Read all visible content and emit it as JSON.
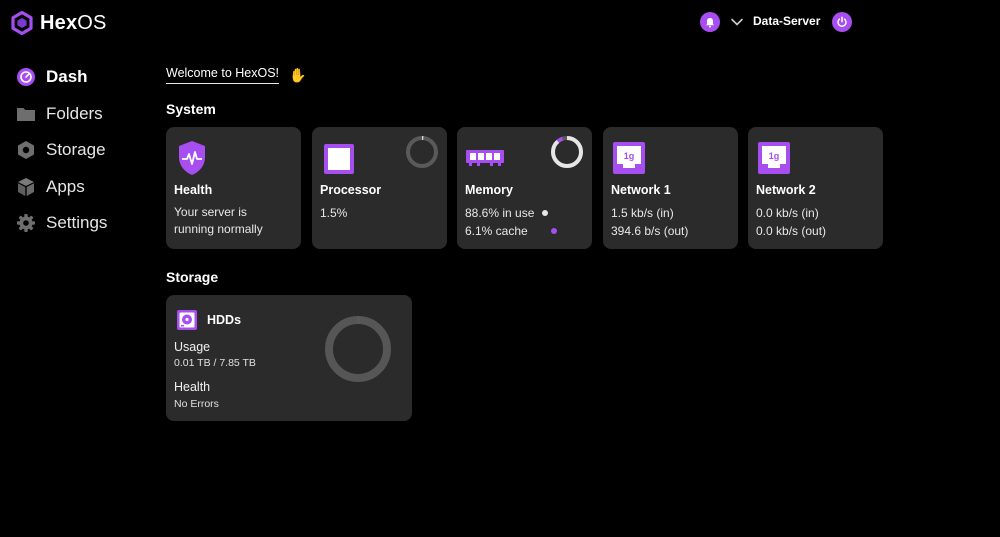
{
  "brand": {
    "name_bold": "Hex",
    "name_light": "OS",
    "accent": "#a64ef0"
  },
  "topbar": {
    "server_name": "Data-Server"
  },
  "sidebar": {
    "items": [
      {
        "label": "Dash",
        "icon": "dash-icon",
        "active": true
      },
      {
        "label": "Folders",
        "icon": "folder-icon",
        "active": false
      },
      {
        "label": "Storage",
        "icon": "storage-icon",
        "active": false
      },
      {
        "label": "Apps",
        "icon": "apps-icon",
        "active": false
      },
      {
        "label": "Settings",
        "icon": "gear-icon",
        "active": false
      }
    ]
  },
  "main": {
    "welcome": "Welcome to HexOS!",
    "system_title": "System",
    "storage_title": "Storage",
    "cards": {
      "health": {
        "title": "Health",
        "line1": "Your server is",
        "line2": "running normally"
      },
      "processor": {
        "title": "Processor",
        "value": "1.5%",
        "usage_fraction": 0.015
      },
      "memory": {
        "title": "Memory",
        "in_use": "88.6% in use",
        "cache": "6.1% cache",
        "in_use_fraction": 0.886,
        "cache_fraction": 0.061
      },
      "network1": {
        "title": "Network 1",
        "in": "1.5 kb/s (in)",
        "out": "394.6 b/s (out)",
        "badge": "1g"
      },
      "network2": {
        "title": "Network 2",
        "in": "0.0 kb/s (in)",
        "out": "0.0 kb/s (out)",
        "badge": "1g"
      }
    },
    "hdds": {
      "title": "HDDs",
      "usage_label": "Usage",
      "usage_value": "0.01 TB / 7.85 TB",
      "usage_fraction": 0.0013,
      "health_label": "Health",
      "health_value": "No Errors"
    }
  }
}
